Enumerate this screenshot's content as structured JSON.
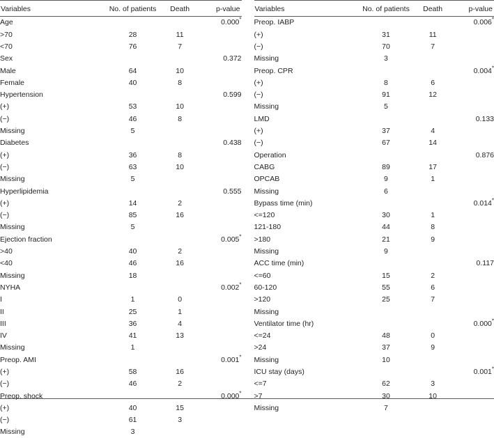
{
  "table": {
    "columns": [
      "Variables",
      "No. of patients",
      "Death",
      "p-value"
    ],
    "left": {
      "header": {
        "variables": "Variables",
        "patients": "No. of patients",
        "death": "Death",
        "pvalue": "p-value"
      },
      "rows": [
        {
          "level": 1,
          "label": "Age",
          "patients": "",
          "death": "",
          "pvalue": "0.000",
          "starred": true
        },
        {
          "level": 2,
          "label": ">70",
          "patients": "28",
          "death": "11",
          "pvalue": "",
          "starred": false
        },
        {
          "level": 2,
          "label": "<70",
          "patients": "76",
          "death": "7",
          "pvalue": "",
          "starred": false
        },
        {
          "level": 1,
          "label": "Sex",
          "patients": "",
          "death": "",
          "pvalue": "0.372",
          "starred": false
        },
        {
          "level": 2,
          "label": "Male",
          "patients": "64",
          "death": "10",
          "pvalue": "",
          "starred": false
        },
        {
          "level": 2,
          "label": "Female",
          "patients": "40",
          "death": "8",
          "pvalue": "",
          "starred": false
        },
        {
          "level": 1,
          "label": "Hypertension",
          "patients": "",
          "death": "",
          "pvalue": "0.599",
          "starred": false
        },
        {
          "level": 2,
          "label": "(+)",
          "patients": "53",
          "death": "10",
          "pvalue": "",
          "starred": false
        },
        {
          "level": 2,
          "label": "(−)",
          "patients": "46",
          "death": "8",
          "pvalue": "",
          "starred": false
        },
        {
          "level": 3,
          "label": "Missing",
          "patients": "5",
          "death": "",
          "pvalue": "",
          "starred": false
        },
        {
          "level": 1,
          "label": "Diabetes",
          "patients": "",
          "death": "",
          "pvalue": "0.438",
          "starred": false
        },
        {
          "level": 2,
          "label": "(+)",
          "patients": "36",
          "death": "8",
          "pvalue": "",
          "starred": false
        },
        {
          "level": 2,
          "label": "(−)",
          "patients": "63",
          "death": "10",
          "pvalue": "",
          "starred": false
        },
        {
          "level": 3,
          "label": "Missing",
          "patients": "5",
          "death": "",
          "pvalue": "",
          "starred": false
        },
        {
          "level": 1,
          "label": "Hyperlipidemia",
          "patients": "",
          "death": "",
          "pvalue": "0.555",
          "starred": false
        },
        {
          "level": 2,
          "label": "(+)",
          "patients": "14",
          "death": "2",
          "pvalue": "",
          "starred": false
        },
        {
          "level": 2,
          "label": "(−)",
          "patients": "85",
          "death": "16",
          "pvalue": "",
          "starred": false
        },
        {
          "level": 3,
          "label": "Missing",
          "patients": "5",
          "death": "",
          "pvalue": "",
          "starred": false
        },
        {
          "level": 1,
          "label": "Ejection fraction",
          "patients": "",
          "death": "",
          "pvalue": "0.005",
          "starred": true
        },
        {
          "level": 2,
          "label": ">40",
          "patients": "40",
          "death": "2",
          "pvalue": "",
          "starred": false
        },
        {
          "level": 2,
          "label": "<40",
          "patients": "46",
          "death": "16",
          "pvalue": "",
          "starred": false
        },
        {
          "level": 3,
          "label": "Missing",
          "patients": "18",
          "death": "",
          "pvalue": "",
          "starred": false
        },
        {
          "level": 1,
          "label": "NYHA",
          "patients": "",
          "death": "",
          "pvalue": "0.002",
          "starred": true
        },
        {
          "level": 2,
          "label": "I",
          "patients": "1",
          "death": "0",
          "pvalue": "",
          "starred": false
        },
        {
          "level": 2,
          "label": "II",
          "patients": "25",
          "death": "1",
          "pvalue": "",
          "starred": false
        },
        {
          "level": 2,
          "label": "III",
          "patients": "36",
          "death": "4",
          "pvalue": "",
          "starred": false
        },
        {
          "level": 2,
          "label": "IV",
          "patients": "41",
          "death": "13",
          "pvalue": "",
          "starred": false
        },
        {
          "level": 3,
          "label": "Missing",
          "patients": "1",
          "death": "",
          "pvalue": "",
          "starred": false
        },
        {
          "level": 1,
          "label": "Preop. AMI",
          "patients": "",
          "death": "",
          "pvalue": "0.001",
          "starred": true
        },
        {
          "level": 2,
          "label": "(+)",
          "patients": "58",
          "death": "16",
          "pvalue": "",
          "starred": false
        },
        {
          "level": 2,
          "label": "(−)",
          "patients": "46",
          "death": "2",
          "pvalue": "",
          "starred": false
        },
        {
          "level": 1,
          "label": "Preop. shock",
          "patients": "",
          "death": "",
          "pvalue": "0.000",
          "starred": true
        },
        {
          "level": 2,
          "label": "(+)",
          "patients": "40",
          "death": "15",
          "pvalue": "",
          "starred": false
        },
        {
          "level": 2,
          "label": "(−)",
          "patients": "61",
          "death": "3",
          "pvalue": "",
          "starred": false
        },
        {
          "level": 3,
          "label": "Missing",
          "patients": "3",
          "death": "",
          "pvalue": "",
          "starred": false
        }
      ]
    },
    "right": {
      "header": {
        "variables": "Variables",
        "patients": "No. of patients",
        "death": "Death",
        "pvalue": "p-value"
      },
      "rows": [
        {
          "level": 1,
          "label": "Preop. IABP",
          "patients": "",
          "death": "",
          "pvalue": "0.006",
          "starred": true
        },
        {
          "level": 2,
          "label": "(+)",
          "patients": "31",
          "death": "11",
          "pvalue": "",
          "starred": false
        },
        {
          "level": 2,
          "label": "(−)",
          "patients": "70",
          "death": "7",
          "pvalue": "",
          "starred": false
        },
        {
          "level": 3,
          "label": "Missing",
          "patients": "3",
          "death": "",
          "pvalue": "",
          "starred": false
        },
        {
          "level": 1,
          "label": "Preop. CPR",
          "patients": "",
          "death": "",
          "pvalue": "0.004",
          "starred": true
        },
        {
          "level": 2,
          "label": "(+)",
          "patients": "8",
          "death": "6",
          "pvalue": "",
          "starred": false
        },
        {
          "level": 2,
          "label": "(−)",
          "patients": "91",
          "death": "12",
          "pvalue": "",
          "starred": false
        },
        {
          "level": 3,
          "label": "Missing",
          "patients": "5",
          "death": "",
          "pvalue": "",
          "starred": false
        },
        {
          "level": 1,
          "label": "LMD",
          "patients": "",
          "death": "",
          "pvalue": "0.133",
          "starred": false
        },
        {
          "level": 2,
          "label": "(+)",
          "patients": "37",
          "death": "4",
          "pvalue": "",
          "starred": false
        },
        {
          "level": 2,
          "label": "(−)",
          "patients": "67",
          "death": "14",
          "pvalue": "",
          "starred": false
        },
        {
          "level": 1,
          "label": "Operation",
          "patients": "",
          "death": "",
          "pvalue": "0.876",
          "starred": false
        },
        {
          "level": 2,
          "label": "CABG",
          "patients": "89",
          "death": "17",
          "pvalue": "",
          "starred": false
        },
        {
          "level": 2,
          "label": "OPCAB",
          "patients": "9",
          "death": "1",
          "pvalue": "",
          "starred": false
        },
        {
          "level": 3,
          "label": "Missing",
          "patients": "6",
          "death": "",
          "pvalue": "",
          "starred": false
        },
        {
          "level": 1,
          "label": "Bypass time (min)",
          "patients": "",
          "death": "",
          "pvalue": "0.014",
          "starred": true
        },
        {
          "level": 2,
          "label": "<=120",
          "patients": "30",
          "death": "1",
          "pvalue": "",
          "starred": false
        },
        {
          "level": 2,
          "label": "121-180",
          "patients": "44",
          "death": "8",
          "pvalue": "",
          "starred": false
        },
        {
          "level": 2,
          "label": ">180",
          "patients": "21",
          "death": "9",
          "pvalue": "",
          "starred": false
        },
        {
          "level": 3,
          "label": "Missing",
          "patients": "9",
          "death": "",
          "pvalue": "",
          "starred": false
        },
        {
          "level": 1,
          "label": "ACC time (min)",
          "patients": "",
          "death": "",
          "pvalue": "0.117",
          "starred": false
        },
        {
          "level": 2,
          "label": "<=60",
          "patients": "15",
          "death": "2",
          "pvalue": "",
          "starred": false
        },
        {
          "level": 2,
          "label": "60-120",
          "patients": "55",
          "death": "6",
          "pvalue": "",
          "starred": false
        },
        {
          "level": 2,
          "label": ">120",
          "patients": "25",
          "death": "7",
          "pvalue": "",
          "starred": false
        },
        {
          "level": 3,
          "label": "Missing",
          "patients": "",
          "death": "",
          "pvalue": "",
          "starred": false
        },
        {
          "level": 1,
          "label": "Ventilator time (hr)",
          "patients": "",
          "death": "",
          "pvalue": "0.000",
          "starred": true
        },
        {
          "level": 2,
          "label": "<=24",
          "patients": "48",
          "death": "0",
          "pvalue": "",
          "starred": false
        },
        {
          "level": 2,
          "label": ">24",
          "patients": "37",
          "death": "9",
          "pvalue": "",
          "starred": false
        },
        {
          "level": 3,
          "label": "Missing",
          "patients": "10",
          "death": "",
          "pvalue": "",
          "starred": false
        },
        {
          "level": 1,
          "label": "ICU stay (days)",
          "patients": "",
          "death": "",
          "pvalue": "0.001",
          "starred": true
        },
        {
          "level": 2,
          "label": "<=7",
          "patients": "62",
          "death": "3",
          "pvalue": "",
          "starred": false
        },
        {
          "level": 2,
          "label": ">7",
          "patients": "30",
          "death": "10",
          "pvalue": "",
          "starred": false
        },
        {
          "level": 3,
          "label": "Missing",
          "patients": "7",
          "death": "",
          "pvalue": "",
          "starred": false
        }
      ]
    }
  }
}
